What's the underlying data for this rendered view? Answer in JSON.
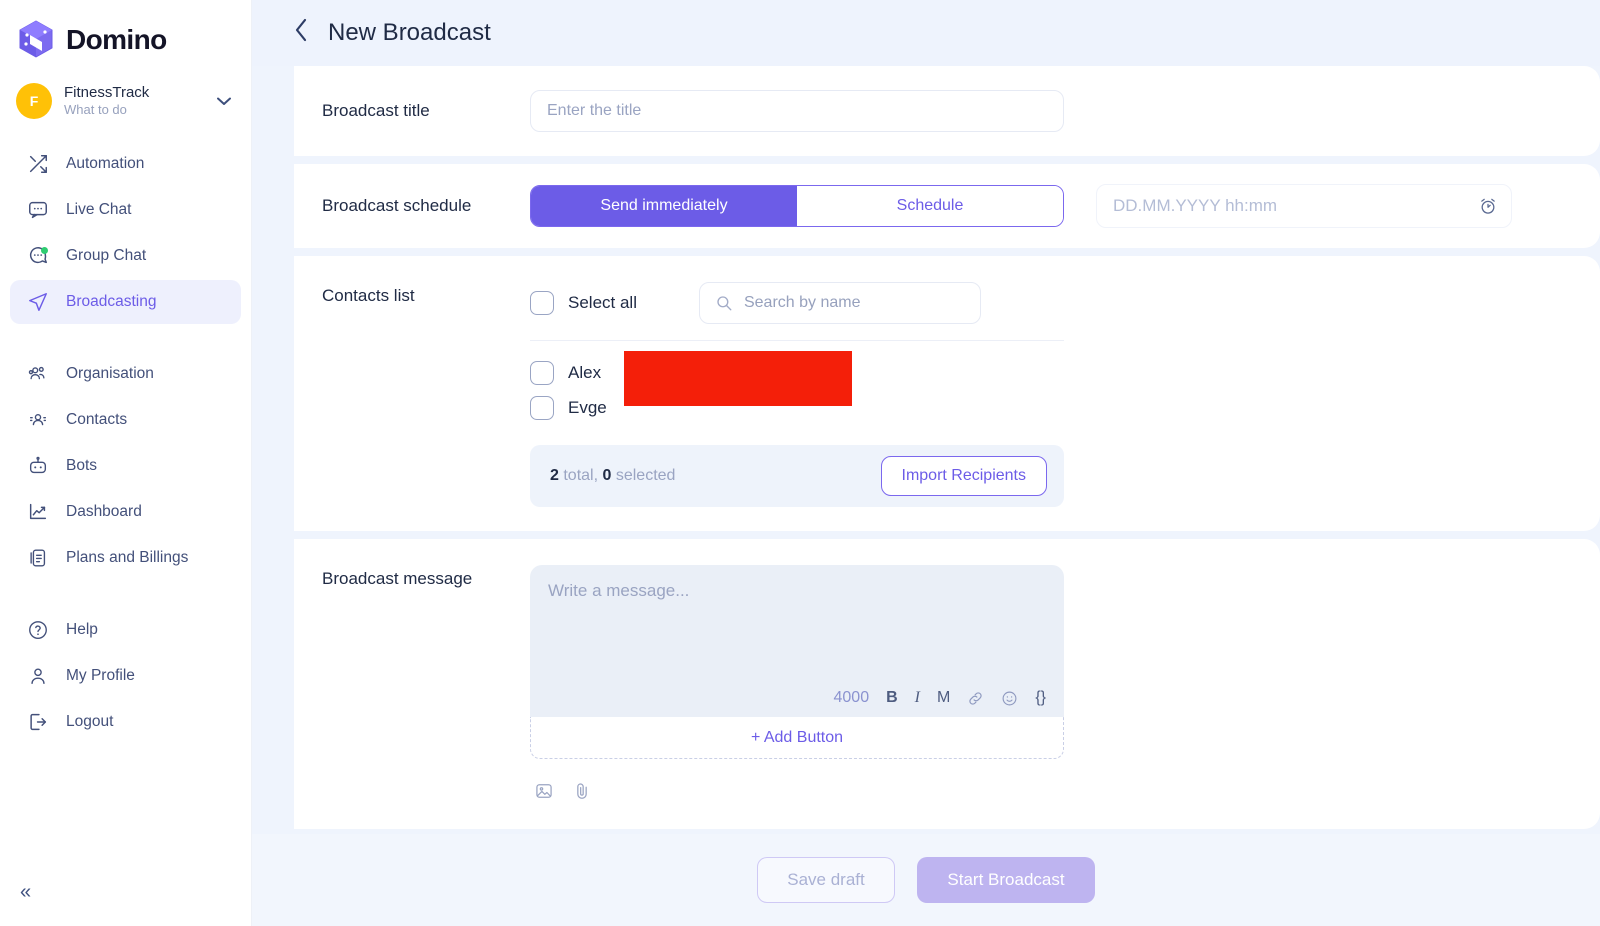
{
  "brand": {
    "name": "Domino",
    "logo_icon": "domino-cube-icon",
    "accent": "#6c5ce7"
  },
  "org": {
    "avatar_initial": "F",
    "avatar_color": "#FFC107",
    "name": "FitnessTrack",
    "subtitle": "What to do",
    "chevron_icon": "chevron-down-icon"
  },
  "sidebar": {
    "items": [
      {
        "label": "Automation",
        "icon": "shuffle-icon",
        "active": false
      },
      {
        "label": "Live Chat",
        "icon": "chat-icon",
        "active": false
      },
      {
        "label": "Group Chat",
        "icon": "group-chat-icon",
        "active": false
      },
      {
        "label": "Broadcasting",
        "icon": "send-icon",
        "active": true
      },
      {
        "label": "Organisation",
        "icon": "people-icon",
        "active": false
      },
      {
        "label": "Contacts",
        "icon": "contacts-icon",
        "active": false
      },
      {
        "label": "Bots",
        "icon": "robot-icon",
        "active": false
      },
      {
        "label": "Dashboard",
        "icon": "chart-icon",
        "active": false
      },
      {
        "label": "Plans and Billings",
        "icon": "billing-icon",
        "active": false
      },
      {
        "label": "Help",
        "icon": "help-icon",
        "active": false
      },
      {
        "label": "My Profile",
        "icon": "user-icon",
        "active": false
      },
      {
        "label": "Logout",
        "icon": "logout-icon",
        "active": false
      }
    ],
    "collapse_label": "«",
    "collapse_icon": "chevrons-left-icon"
  },
  "header": {
    "back_icon": "chevron-left-icon",
    "title": "New Broadcast"
  },
  "broadcast_title": {
    "label": "Broadcast title",
    "placeholder": "Enter the title",
    "value": ""
  },
  "schedule": {
    "label": "Broadcast schedule",
    "options": [
      {
        "label": "Send immediately",
        "selected": true
      },
      {
        "label": "Schedule",
        "selected": false
      }
    ],
    "datetime_placeholder": "DD.MM.YYYY hh:mm",
    "datetime_value": "",
    "datetime_icon": "alarm-clock-icon"
  },
  "contacts": {
    "label": "Contacts list",
    "select_all_label": "Select all",
    "select_all_checked": false,
    "search_placeholder": "Search by name",
    "search_value": "",
    "search_icon": "search-icon",
    "rows": [
      {
        "name": "Alex",
        "checked": false
      },
      {
        "name": "Evge",
        "checked": false
      }
    ],
    "totals_count": "2",
    "totals_word": " total, ",
    "selected_count": "0",
    "selected_word": " selected",
    "import_label": "Import Recipients"
  },
  "message": {
    "label": "Broadcast message",
    "placeholder": "Write a message...",
    "value": "",
    "char_counter": "4000",
    "tools": [
      {
        "label": "B",
        "icon": "bold-icon"
      },
      {
        "label": "I",
        "icon": "italic-icon"
      },
      {
        "label": "M",
        "icon": "markdown-icon"
      },
      {
        "label": "",
        "icon": "link-icon"
      },
      {
        "label": "",
        "icon": "emoji-icon"
      },
      {
        "label": "{}",
        "icon": "variable-braces-icon"
      }
    ],
    "add_button_label": "+ Add Button",
    "attachments": [
      {
        "icon": "image-icon"
      },
      {
        "icon": "paperclip-icon"
      }
    ]
  },
  "footer": {
    "save_draft_label": "Save draft",
    "start_broadcast_label": "Start Broadcast"
  }
}
